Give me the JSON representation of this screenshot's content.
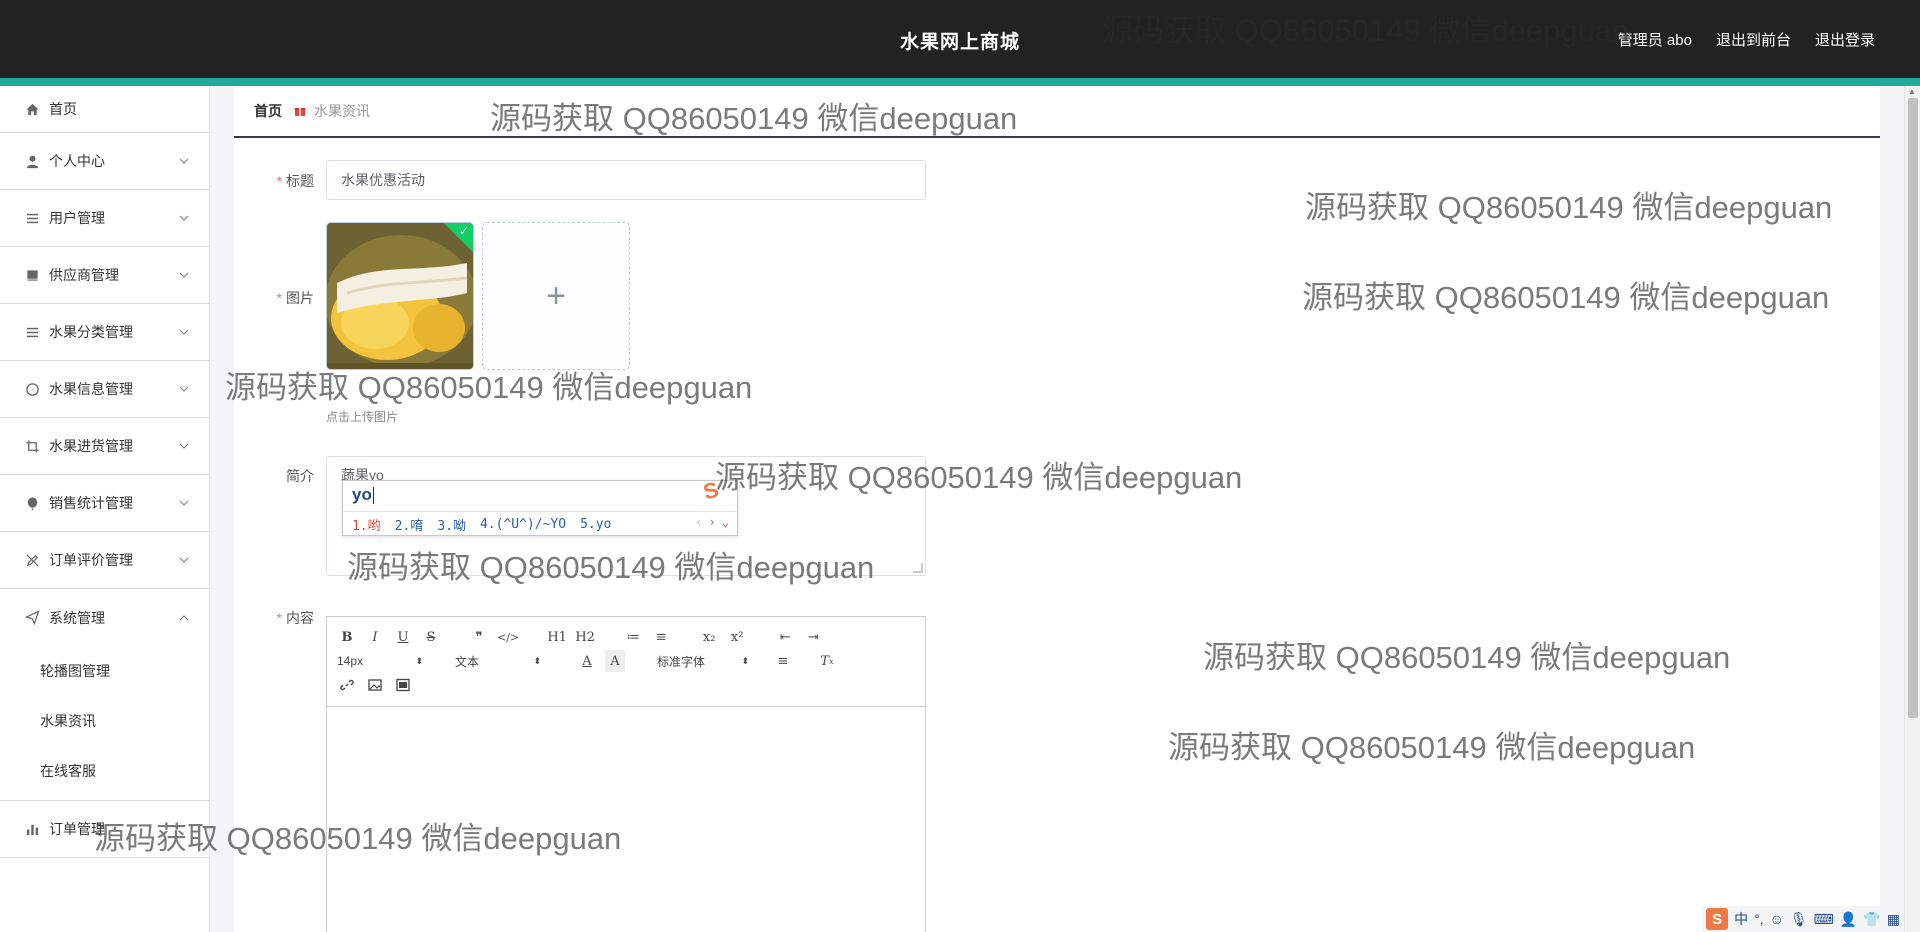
{
  "header": {
    "app_title": "水果网上商城",
    "admin_label": "管理员 abo",
    "to_front": "退出到前台",
    "logout": "退出登录"
  },
  "sidebar": {
    "items": [
      {
        "label": "首页",
        "icon": "home-icon"
      },
      {
        "label": "个人中心",
        "icon": "user-icon"
      },
      {
        "label": "用户管理",
        "icon": "list-icon"
      },
      {
        "label": "供应商管理",
        "icon": "book-icon"
      },
      {
        "label": "水果分类管理",
        "icon": "list-icon"
      },
      {
        "label": "水果信息管理",
        "icon": "compass-icon"
      },
      {
        "label": "水果进货管理",
        "icon": "crop-icon"
      },
      {
        "label": "销售统计管理",
        "icon": "balloon-icon"
      },
      {
        "label": "订单评价管理",
        "icon": "edit-off-icon"
      },
      {
        "label": "系统管理",
        "icon": "send-icon"
      },
      {
        "label": "订单管理",
        "icon": "bar-chart-icon"
      }
    ],
    "sub_items": [
      "轮播图管理",
      "水果资讯",
      "在线客服"
    ]
  },
  "breadcrumb": {
    "home": "首页",
    "current": "水果资讯"
  },
  "form": {
    "title_label": "标题",
    "title_value": "水果优惠活动",
    "image_label": "图片",
    "upload_tip": "点击上传图片",
    "intro_label": "简介",
    "intro_value": "蔬果yo",
    "content_label": "内容"
  },
  "ime": {
    "input": "yo",
    "candidates": [
      "1.哟",
      "2.唷",
      "3.呦",
      "4.(^U^)/~YO",
      "5.yo"
    ]
  },
  "editor": {
    "row1": [
      "B",
      "I",
      "U",
      "S",
      "❞",
      "</>",
      "H1",
      "H2",
      "≔",
      "≡",
      "x₂",
      "x²",
      "⇤",
      "⇥"
    ],
    "font_size": "14px",
    "block_type": "文本",
    "font_family": "标准字体"
  },
  "watermark": "源码获取 QQ86050149 微信deepguan",
  "tray": {
    "lang": "中"
  },
  "colors": {
    "topbar": "#222222",
    "accent": "#21a99a",
    "required": "#f56c6c",
    "success": "#13ce66"
  }
}
